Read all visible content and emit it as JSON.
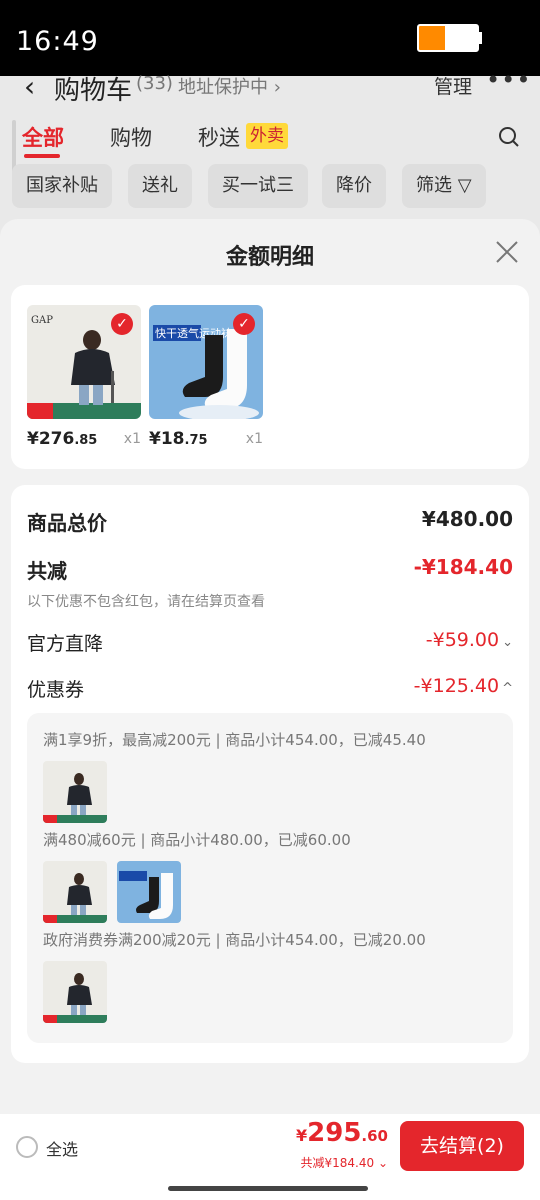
{
  "status_bar": {
    "time": "16:49",
    "battery_level": 0.45
  },
  "background": {
    "title": "购物车",
    "count": "(33)",
    "address_protect": "地址保护中 ›",
    "manage": "管理",
    "more": "•••",
    "tabs": [
      "全部",
      "购物",
      "秒送"
    ],
    "takeout_badge": "外卖",
    "filters": [
      "国家补贴",
      "送礼",
      "买一试三",
      "降价",
      "筛选"
    ]
  },
  "sheet": {
    "title": "金额明细",
    "products": [
      {
        "brand": "GAP",
        "price_int": "¥276",
        "price_dec": ".85",
        "qty": "x1"
      },
      {
        "brand": "快干透气运动袜",
        "price_int": "¥18",
        "price_dec": ".75",
        "qty": "x1"
      }
    ],
    "detail": {
      "total_label": "商品总价",
      "total_value": "¥480.00",
      "reduce_label": "共减",
      "reduce_value": "-¥184.40",
      "hint": "以下优惠不包含红包，请在结算页查看",
      "direct_label": "官方直降",
      "direct_value": "-¥59.00",
      "coupon_label": "优惠券",
      "coupon_value": "-¥125.40"
    },
    "coupons": [
      {
        "text": "满1享9折，最高减200元 | 商品小计454.00，已减45.40"
      },
      {
        "text": "满480减60元 | 商品小计480.00，已减60.00"
      },
      {
        "text": "政府消费券满200减20元 | 商品小计454.00，已减20.00"
      }
    ]
  },
  "bottom": {
    "select_all": "全选",
    "currency": "¥",
    "price_int": "295",
    "price_dec": ".60",
    "saved": "共减¥184.40",
    "checkout": "去结算(2)"
  },
  "colors": {
    "accent": "#e4262c",
    "badge": "#ffd93a"
  }
}
